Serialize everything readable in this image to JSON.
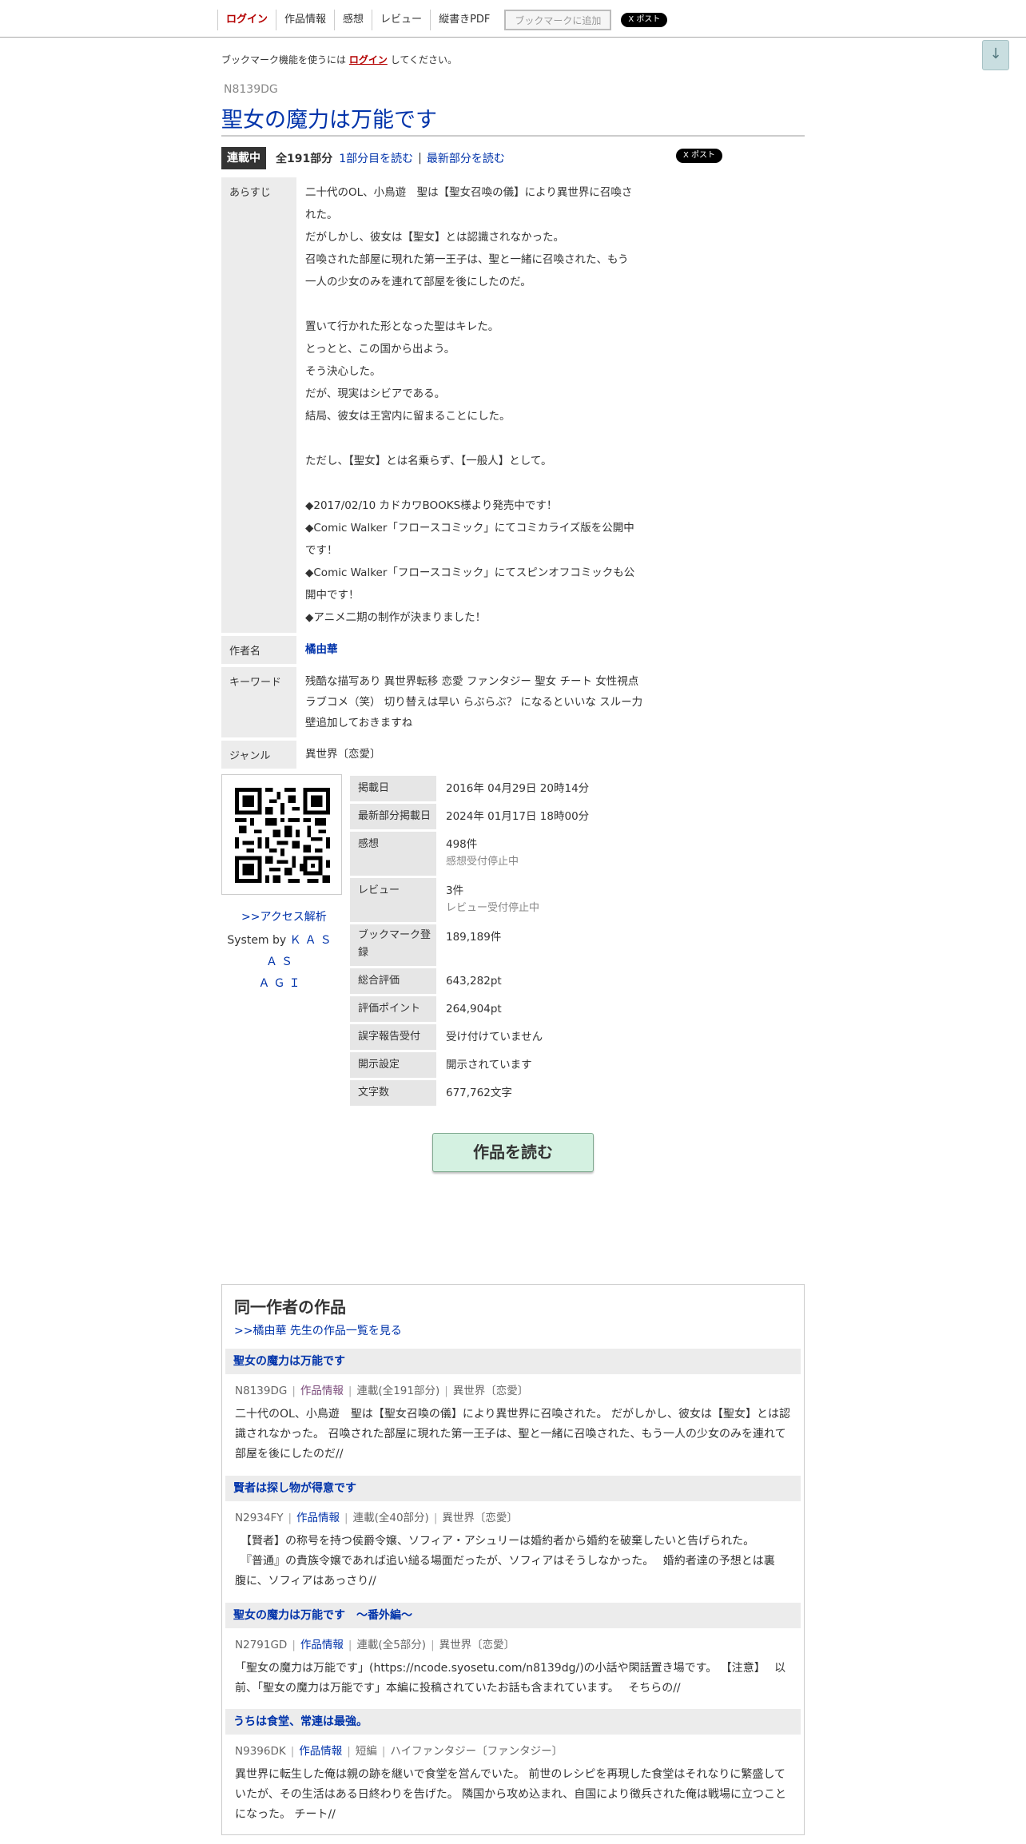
{
  "nav": {
    "login": "ログイン",
    "work_info": "作品情報",
    "impressions": "感想",
    "review": "レビュー",
    "vertical_pdf": "縦書きPDF",
    "bookmark_add": "ブックマークに追加",
    "x_post": "X ポスト"
  },
  "scroll_down_icon": "arrow-down-icon",
  "bookmark_note": {
    "before": "ブックマーク機能を使うには",
    "login_link": "ログイン",
    "after": "してください。"
  },
  "novel": {
    "ncode": "N8139DG",
    "title": "聖女の魔力は万能です",
    "status": "連載中",
    "total_parts": "全191部分",
    "first_link": "1部分目を読む",
    "separator": "|",
    "latest_link": "最新部分を読む",
    "share_x": "X ポスト"
  },
  "info": {
    "synopsis_label": "あらすじ",
    "synopsis_lines": [
      "二十代のOL、小鳥遊　聖は【聖女召喚の儀】により異世界に召喚さ",
      "れた。",
      "だがしかし、彼女は【聖女】とは認識されなかった。",
      "召喚された部屋に現れた第一王子は、聖と一緒に召喚された、もう",
      "一人の少女のみを連れて部屋を後にしたのだ。",
      "",
      "置いて行かれた形となった聖はキレた。",
      "とっとと、この国から出よう。",
      "そう決心した。",
      "だが、現実はシビアである。",
      "結局、彼女は王宮内に留まることにした。",
      "",
      "ただし、【聖女】とは名乗らず、【一般人】として。",
      "",
      "◆2017/02/10 カドカワBOOKS様より発売中です！",
      "◆Comic Walker「フロースコミック」にてコミカライズ版を公開中",
      "です！",
      "◆Comic Walker「フロースコミック」にてスピンオフコミックも公",
      "開中です！",
      "◆アニメ二期の制作が決まりました！"
    ],
    "author_label": "作者名",
    "author": "橘由華",
    "keywords_label": "キーワード",
    "keyword_lines": [
      "残酷な描写あり 異世界転移 恋愛 ファンタジー 聖女 チート 女性視点",
      "ラブコメ（笑） 切り替えは早い らぶらぶ？ になるといいな スルー力",
      "壁追加しておきますね"
    ],
    "genre_label": "ジャンル",
    "genre": "異世界〔恋愛〕"
  },
  "qr_icon": "qr-code-icon",
  "access_link": ">>アクセス解析",
  "system_by": {
    "prefix": "System by",
    "name_line1": "ＫＡＳＡＳ",
    "name_line2": "ＡＧＩ"
  },
  "stats": [
    {
      "label": "掲載日",
      "value": "2016年 04月29日 20時14分",
      "sub": ""
    },
    {
      "label": "最新部分掲載日",
      "value": "2024年 01月17日 18時00分",
      "sub": ""
    },
    {
      "label": "感想",
      "value": "498件",
      "sub": "感想受付停止中"
    },
    {
      "label": "レビュー",
      "value": "3件",
      "sub": "レビュー受付停止中"
    },
    {
      "label": "ブックマーク登録",
      "value": "189,189件",
      "sub": ""
    },
    {
      "label": "総合評価",
      "value": "643,282pt",
      "sub": ""
    },
    {
      "label": "評価ポイント",
      "value": "264,904pt",
      "sub": ""
    },
    {
      "label": "誤字報告受付",
      "value": "受け付けていません",
      "sub": ""
    },
    {
      "label": "開示設定",
      "value": "開示されています",
      "sub": ""
    },
    {
      "label": "文字数",
      "value": "677,762文字",
      "sub": ""
    }
  ],
  "read_button": "作品を読む",
  "same_author": {
    "heading": "同一作者の作品",
    "list_link": ">>橘由華 先生の作品一覧を見る",
    "works": [
      {
        "title": "聖女の魔力は万能です",
        "ncode": "N8139DG",
        "info_link": "作品情報",
        "type": "連載(全191部分)",
        "genre": "異世界〔恋愛〕",
        "desc_lines": [
          "二十代のOL、小鳥遊　聖は【聖女召喚の儀】により異世界に召喚された。 だがしかし、彼女は【聖女】とは認",
          "識されなかった。 召喚された部屋に現れた第一王子は、聖と一緒に召喚された、もう一人の少女のみを連れて",
          "部屋を後にしたのだ//"
        ]
      },
      {
        "title": "賢者は探し物が得意です",
        "ncode": "N2934FY",
        "info_link": "作品情報",
        "type": "連載(全40部分)",
        "genre": "異世界〔恋愛〕",
        "desc_lines": [
          "　【賢者】の称号を持つ侯爵令嬢、ソフィア・アシュリーは婚約者から婚約を破棄したいと告げられた。",
          "　『普通』の貴族令嬢であれば追い縋る場面だったが、ソフィアはそうしなかった。　 婚約者達の予想とは裏",
          "腹に、ソフィアはあっさり//"
        ]
      },
      {
        "title": "聖女の魔力は万能です　～番外編～",
        "ncode": "N2791GD",
        "info_link": "作品情報",
        "type": "連載(全5部分)",
        "genre": "異世界〔恋愛〕",
        "desc_lines": [
          "「聖女の魔力は万能です」(https://ncode.syosetu.com/n8139dg/)の小話や閑話置き場です。 【注意】　 以",
          "前、「聖女の魔力は万能です」本編に投稿されていたお話も含まれています。　 そちらの//"
        ]
      },
      {
        "title": "うちは食堂、常連は最強。",
        "ncode": "N9396DK",
        "info_link": "作品情報",
        "type": "短編",
        "genre": "ハイファンタジー〔ファンタジー〕",
        "desc_lines": [
          "異世界に転生した俺は親の跡を継いで食堂を営んでいた。 前世のレシピを再現した食堂はそれなりに繁盛して",
          "いたが、その生活はある日終わりを告げた。 隣国から攻め込まれ、自国により徴兵された俺は戦場に立つこと",
          "になった。 チート//"
        ]
      }
    ]
  }
}
